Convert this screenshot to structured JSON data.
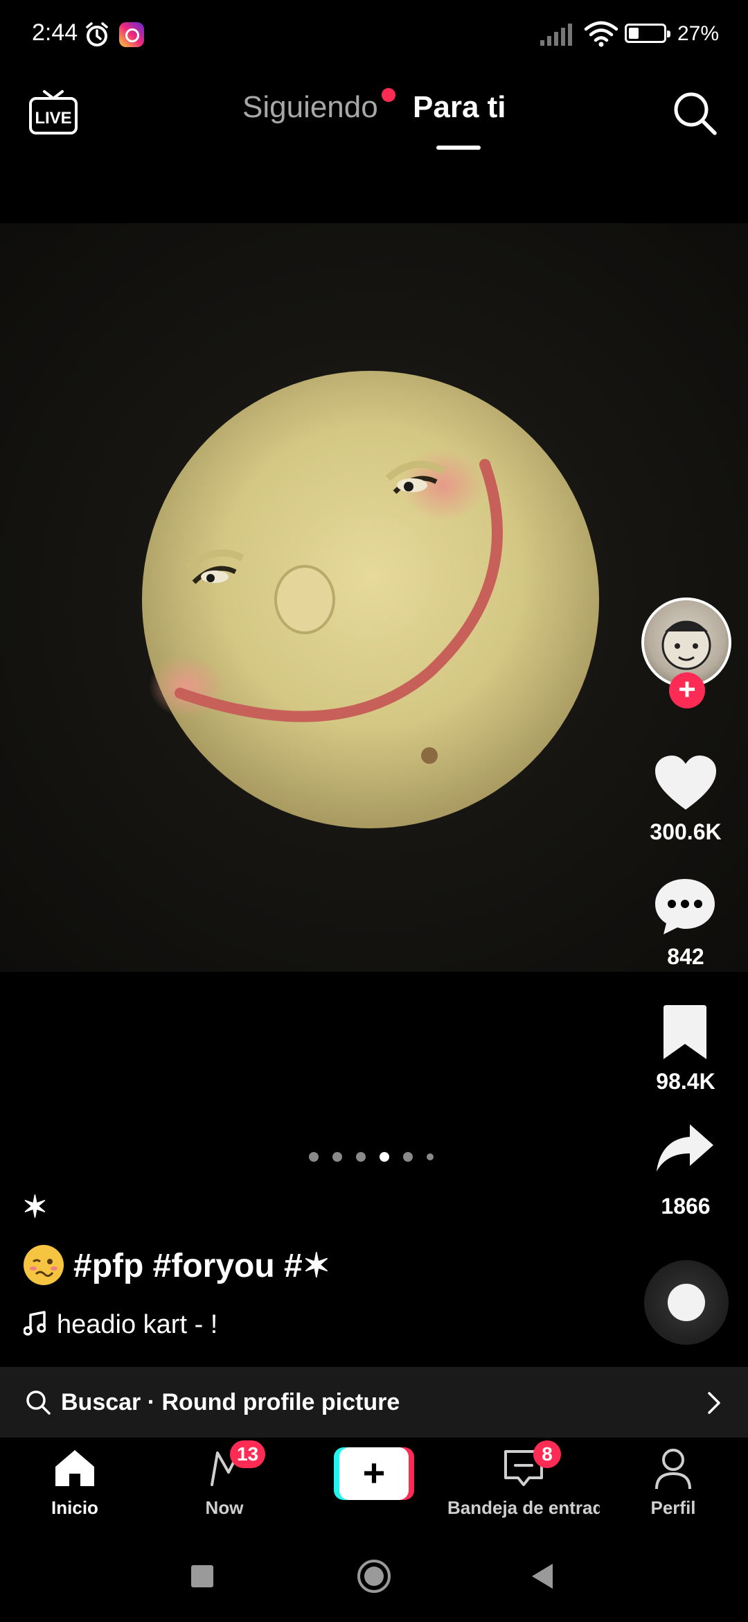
{
  "status_bar": {
    "time": "2:44",
    "battery": "27%"
  },
  "top_nav": {
    "live_label": "LIVE",
    "tabs": [
      {
        "label": "Siguiendo",
        "active": false,
        "has_dot": true
      },
      {
        "label": "Para ti",
        "active": true
      }
    ]
  },
  "rail": {
    "likes": "300.6K",
    "comments": "842",
    "saves": "98.4K",
    "shares": "1866"
  },
  "carousel": {
    "count": 6,
    "active_index": 3
  },
  "caption": {
    "star": "✶",
    "text": "#pfp #foryou #✶",
    "music": "headio kart - !"
  },
  "search_suggestion": {
    "text": "Buscar · Round profile picture"
  },
  "bottom_nav": {
    "items": [
      {
        "label": "Inicio",
        "active": true
      },
      {
        "label": "Now",
        "badge": "13"
      },
      {
        "label": ""
      },
      {
        "label": "Bandeja de entrada",
        "badge": "8"
      },
      {
        "label": "Perfil"
      }
    ]
  },
  "colors": {
    "accent": "#fe2c55",
    "cyan": "#25f4ee",
    "background": "#000000"
  }
}
